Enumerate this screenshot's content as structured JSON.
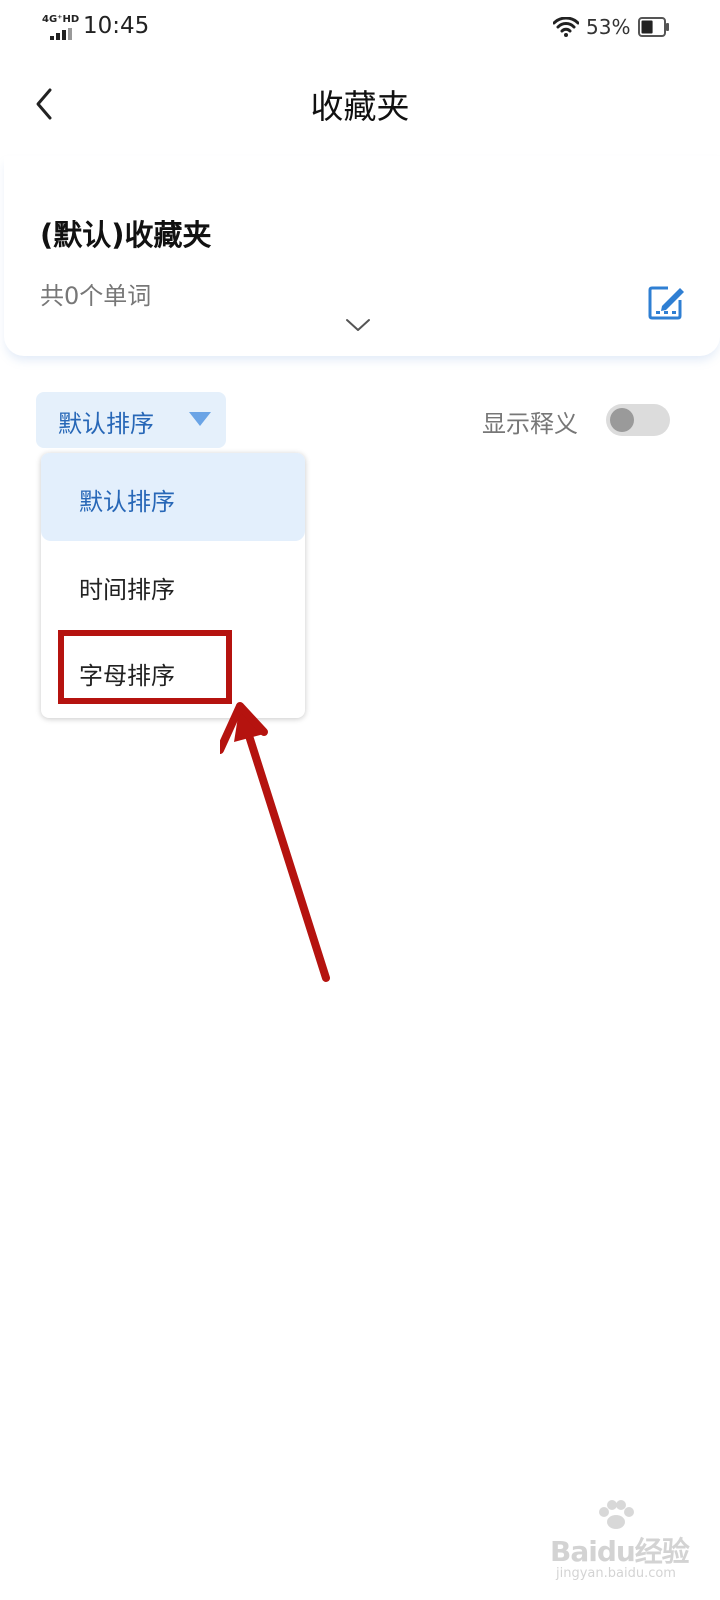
{
  "status_bar": {
    "network": "4G⁺HD",
    "time": "10:45",
    "battery_percent": "53%",
    "battery_level": 0.53
  },
  "header": {
    "title": "收藏夹"
  },
  "folder": {
    "name": "(默认)收藏夹",
    "word_count": "共0个单词"
  },
  "sort": {
    "current": "默认排序",
    "options": [
      {
        "label": "默认排序",
        "selected": true
      },
      {
        "label": "时间排序",
        "selected": false
      },
      {
        "label": "字母排序",
        "selected": false
      }
    ]
  },
  "show_meaning": {
    "label": "显示释义",
    "enabled": false
  },
  "watermark": {
    "brand": "Baidu经验",
    "url": "jingyan.baidu.com"
  },
  "colors": {
    "accent": "#2767b7",
    "accent_bg": "#e5f0fb",
    "annotation": "#b5130f"
  }
}
